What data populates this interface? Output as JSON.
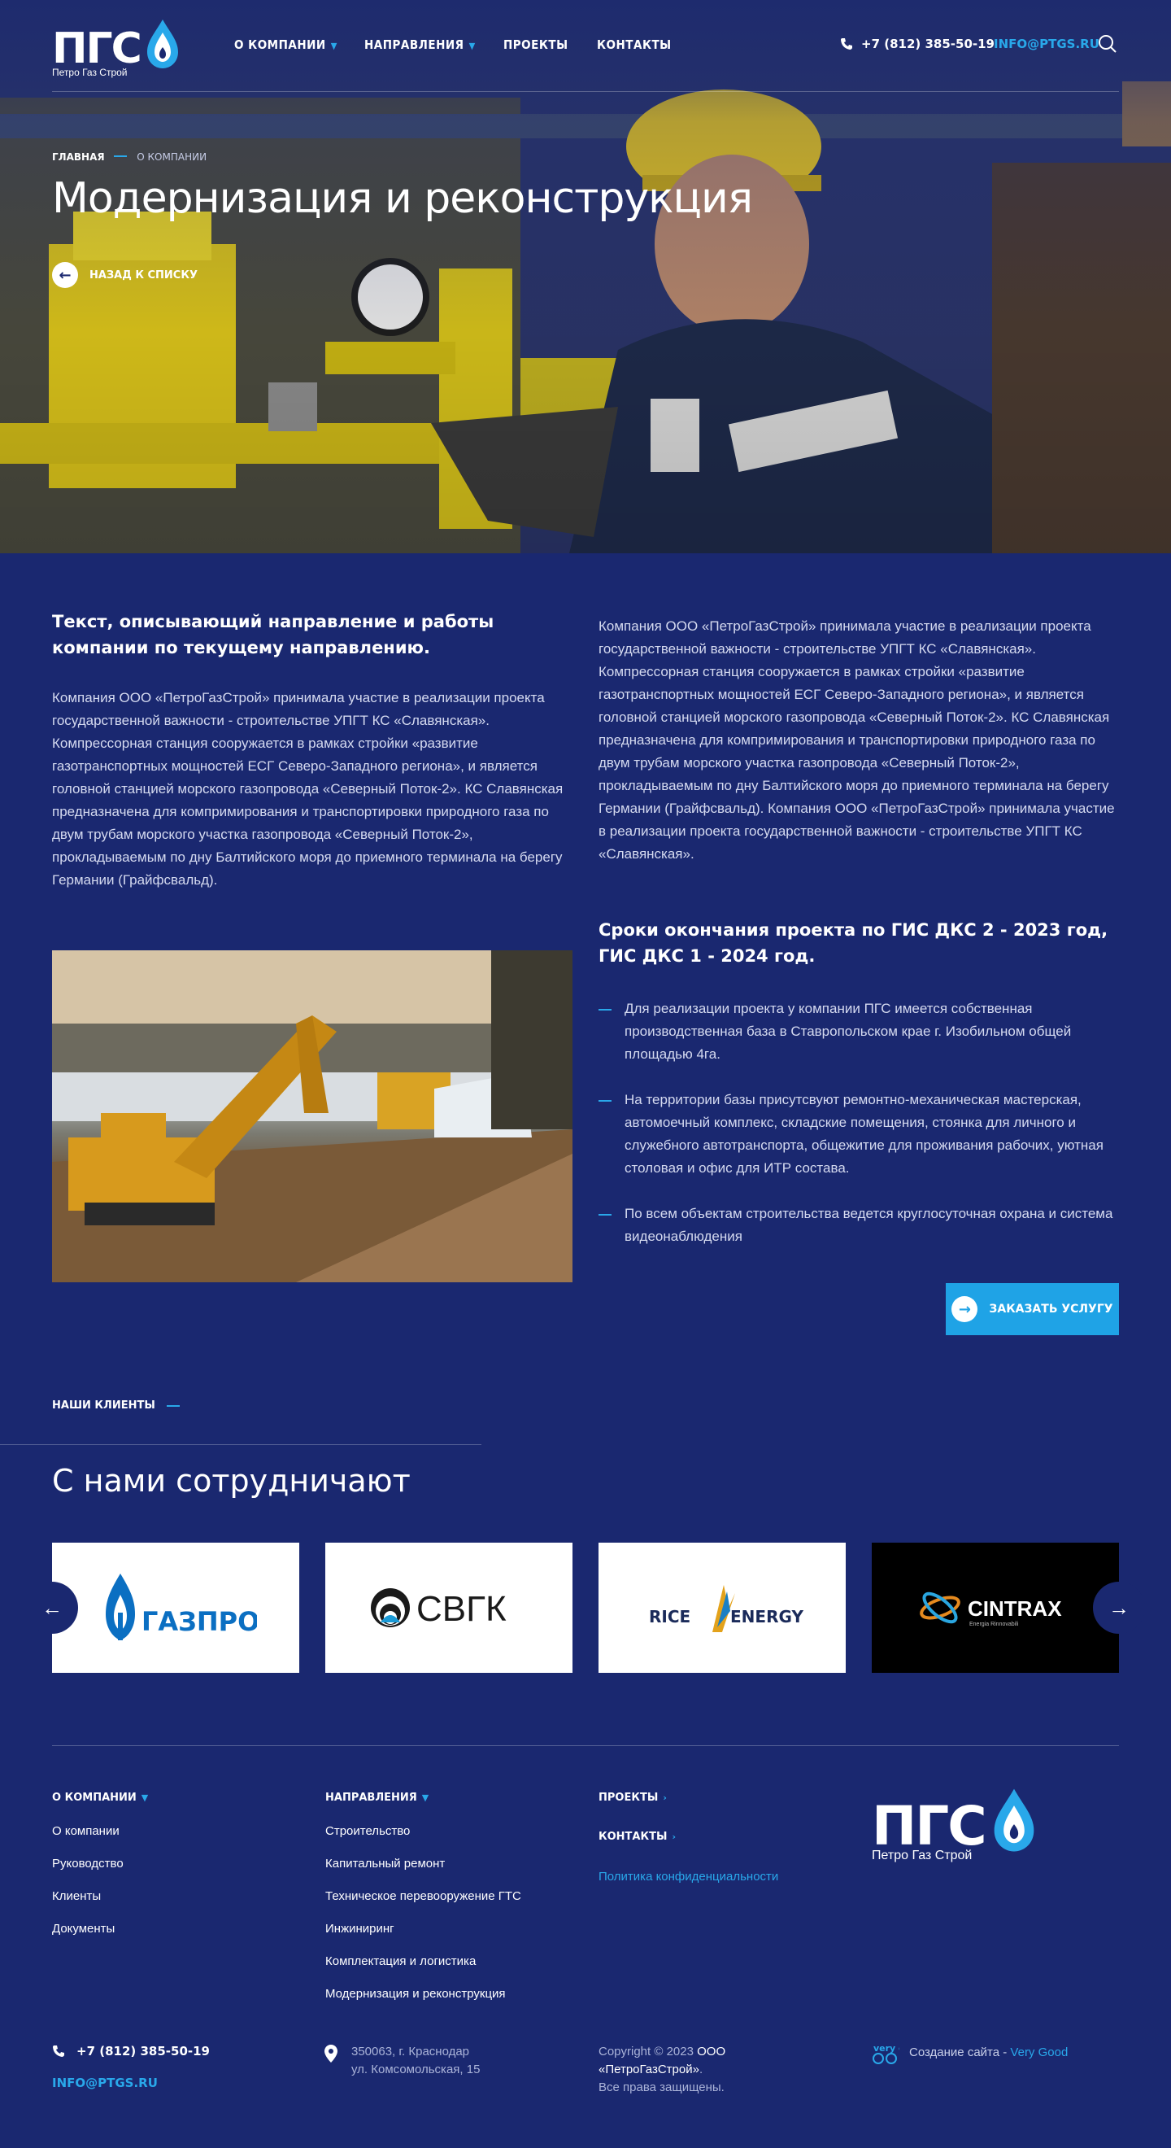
{
  "header": {
    "logo_text": "ПГС",
    "logo_sub": "Петро Газ Строй",
    "nav": [
      {
        "label": "О КОМПАНИИ",
        "dropdown": true
      },
      {
        "label": "НАПРАВЛЕНИЯ",
        "dropdown": true
      },
      {
        "label": "ПРОЕКТЫ",
        "dropdown": false
      },
      {
        "label": "КОНТАКТЫ",
        "dropdown": false
      }
    ],
    "phone": "+7 (812) 385-50-19",
    "email": "INFO@PTGS.RU"
  },
  "hero": {
    "breadcrumb_home": "ГЛАВНАЯ",
    "breadcrumb_current": "О КОМПАНИИ",
    "title": "Модернизация и реконструкция",
    "back_label": "НАЗАД К СПИСКУ"
  },
  "content": {
    "lead_title": "Текст, описывающий направление и работы компании по текущему направлению.",
    "left_paragraph": "Компания ООО «ПетроГазСтрой» принимала участие в реализации проекта государственной важности -  строительстве УПГТ КС «Славянская». Компрессорная станция сооружается в рамках стройки «развитие газотранспортных мощностей ЕСГ Северо-Западного региона», и является головной станцией морского газопровода «Северный Поток-2». КС Славянская предназначена для компримирования и транспортировки природного газа по двум трубам морского участка  газопровода «Северный Поток-2», прокладываемым по дну Балтийского моря до приемного терминала на берегу Германии (Грайфсвальд).",
    "right_paragraph": "Компания ООО «ПетроГазСтрой» принимала участие в реализации проекта государственной важности -  строительстве УПГТ КС «Славянская». Компрессорная станция сооружается в рамках стройки «развитие газотранспортных мощностей ЕСГ Северо-Западного региона», и является головной станцией морского газопровода «Северный Поток-2». КС Славянская предназначена для компримирования и транспортировки природного газа по двум трубам морского участка  газопровода «Северный Поток-2», прокладываемым по дну Балтийского моря до приемного терминала на берегу Германии (Грайфсвальд). Компания ООО «ПетроГазСтрой» принимала участие в реализации проекта государственной важности -  строительстве УПГТ КС «Славянская».",
    "deadline_title": "Сроки окончания проекта по ГИС ДКС 2 - 2023 год, ГИС ДКС 1 - 2024 год.",
    "bullets": [
      "Для реализации проекта у компании ПГС имеется собственная производственная база в Ставропольском крае г. Изобильном общей площадью 4га.",
      "На территории базы присутсвуют ремонтно-механическая мастерская, автомоечный комплекс, складские помещения, стоянка для личного и служебного автотранспорта, общежитие для проживания рабочих, уютная столовая и офис для ИТР состава.",
      "По всем объектам строительства ведется круглосуточная охрана и система видеонаблюдения"
    ],
    "order_button": "ЗАКАЗАТЬ УСЛУГУ"
  },
  "clients": {
    "label": "НАШИ КЛИЕНТЫ",
    "title": "С нами сотрудничают",
    "logos": [
      "ГАЗПРОМ",
      "СВГК",
      "RICE",
      "ENERGY",
      "CINTRAX",
      "Energia Rinnovabili"
    ]
  },
  "footer": {
    "col1": {
      "title": "О КОМПАНИИ",
      "links": [
        "О компании",
        "Руководство",
        "Клиенты",
        "Документы"
      ]
    },
    "col2": {
      "title": "НАПРАВЛЕНИЯ",
      "links": [
        "Строительство",
        "Капитальный ремонт",
        "Техническое перевооружение ГТС",
        "Инжиниринг",
        "Комплектация и логистика",
        "Модернизация и реконструкция"
      ]
    },
    "projects": "ПРОЕКТЫ",
    "contacts": "КОНТАКТЫ",
    "privacy": "Политика конфиденциальности",
    "phone": "+7 (812) 385-50-19",
    "email": "INFO@PTGS.RU",
    "address_line1": "350063, г. Краснодар",
    "address_line2": "ул. Комсомольская, 15",
    "copyright_prefix": "Copyright © 2023 ",
    "copyright_company": "ООО «ПетроГазСтрой»",
    "copyright_suffix": ".",
    "rights": "Все права защищены.",
    "made_by_prefix": "Создание сайта - ",
    "made_by_link": "Very Good",
    "made_by_logo": "very good"
  },
  "colors": {
    "background": "#1a2870",
    "accent": "#29a8ea",
    "button": "#1fa3e6"
  }
}
